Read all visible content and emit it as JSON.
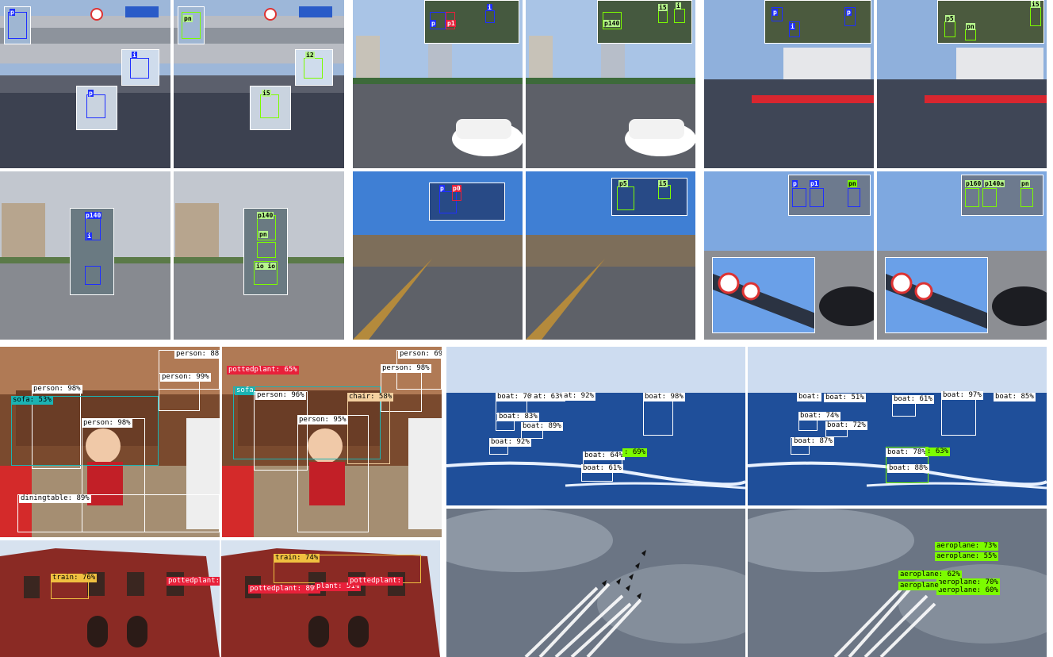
{
  "traffic_signs": {
    "row1": {
      "scene_a": {
        "left_tags": [
          "p",
          "i",
          "p"
        ],
        "right_tags": [
          "pn",
          "i2",
          "i5"
        ]
      },
      "scene_b": {
        "left_tags": [
          "p",
          "p1",
          "i"
        ],
        "right_tags": [
          "p140",
          "i5",
          "i"
        ]
      },
      "scene_c": {
        "left_tags": [
          "p",
          "i",
          "p"
        ],
        "right_tags": [
          "p5",
          "pn",
          "i5"
        ]
      }
    },
    "row2": {
      "scene_d": {
        "left_tags": [
          "p140",
          "i"
        ],
        "right_tags": [
          "p140",
          "pn",
          "io io"
        ]
      },
      "scene_e": {
        "left_tags": [
          "p",
          "p0"
        ],
        "right_tags": [
          "p5",
          "i5"
        ]
      },
      "scene_f": {
        "left_tags": [
          "p",
          "p1",
          "pn"
        ],
        "right_tags": [
          "p160",
          "p140a",
          "pn"
        ]
      }
    }
  },
  "voc_living_room": {
    "left": [
      {
        "label": "person: 88",
        "color": "#ffffff"
      },
      {
        "label": "person: 99%",
        "color": "#ffffff"
      },
      {
        "label": "person: 98%",
        "color": "#ffffff"
      },
      {
        "label": "sofa: 53%",
        "color": "#1bb3b3"
      },
      {
        "label": "person: 98%",
        "color": "#ffffff"
      },
      {
        "label": "diningtable: 89%",
        "color": "#ffffff"
      }
    ],
    "right": [
      {
        "label": "person: 69",
        "color": "#ffffff"
      },
      {
        "label": "person: 98%",
        "color": "#ffffff"
      },
      {
        "label": "pottedplant: 65%",
        "color": "#e8203a"
      },
      {
        "label": "sofa",
        "color": "#1bb3b3"
      },
      {
        "label": "person: 96%",
        "color": "#ffffff"
      },
      {
        "label": "chair: 58%",
        "color": "#f3d0a0"
      },
      {
        "label": "person: 95%",
        "color": "#ffffff"
      }
    ]
  },
  "voc_boats": {
    "left": [
      "boat: 70%",
      "at: 63%",
      "at: 92%",
      "boat: 98%",
      "boat: 83%",
      "boat: 89%",
      "boat: 92%",
      "boat: 64%",
      ": 69%",
      "boat: 61%"
    ],
    "right": [
      "boat:",
      "boat: 51%",
      "boat: 61%",
      "boat: 97%",
      "boat: 85%",
      "boat: 74%",
      "boat: 72%",
      "boat: 87%",
      "boat: 78%",
      ": 63%",
      "boat: 88%"
    ]
  },
  "voc_pub": {
    "left": [
      "train: 76%",
      "pottedplant:"
    ],
    "right": [
      "train: 74%",
      "pottedplant: 89%",
      "plant: 51%",
      "pottedplant:"
    ]
  },
  "voc_aeroplanes": {
    "right": [
      "aeroplane: 73%",
      "aeroplane: 55%",
      "aeroplane: 62%",
      "aeroplane: 70%",
      "aeroplane: 60%",
      "aeroplane"
    ]
  },
  "colors": {
    "sky": "#8fb3e0",
    "road": "#6c6f78",
    "sea": "#1f4f9a",
    "storm": "#6b7584",
    "brick": "#8a2a24",
    "green_box": "#7cfc00",
    "blue_box": "#1f2fff",
    "red_box": "#e8203a"
  }
}
